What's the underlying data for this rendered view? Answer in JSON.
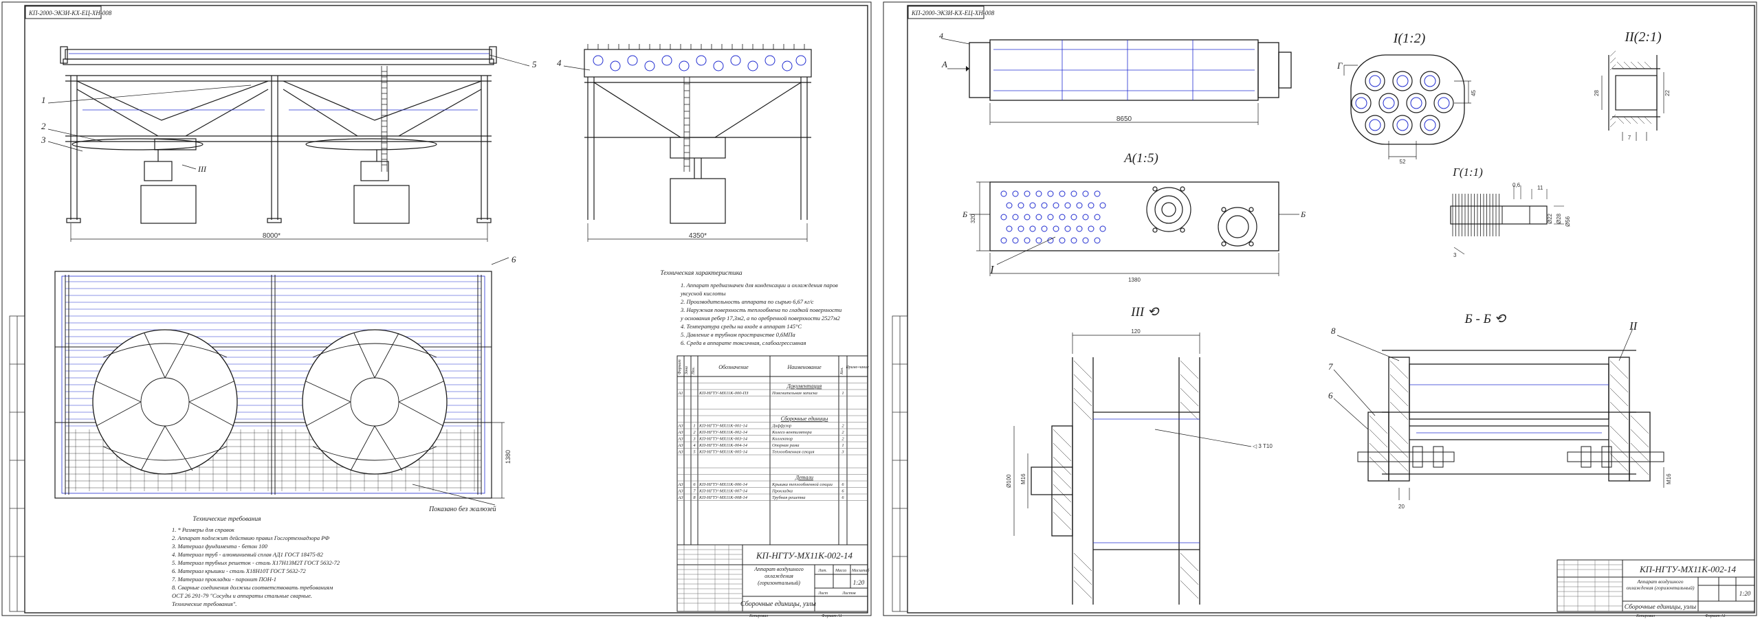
{
  "sheet1": {
    "stamp": "КП-2000-ЭКЗИ-КХ-ЕЦ-ХН-008",
    "positions": [
      "1",
      "2",
      "3",
      "4",
      "5",
      "6"
    ],
    "dims": {
      "length": "8000*",
      "width": "4350*",
      "section_height": "1380"
    },
    "callout_iii": "III",
    "label_hidden": "Показано без жалюзей",
    "tech_char": {
      "title": "Техническая характеристика",
      "lines": [
        "1. Аппарат предназначен для конденсации и охлаждения паров",
        "уксусной кислоты",
        "2. Производительность аппарата по сырью 6,67 кг/с",
        "3. Наружная поверхность теплообмена по гладкой поверхности",
        "у основания ребер 17,3м2, а по оребренной поверхности 2527м2",
        "4. Температура среды на входе в аппарат 145°С",
        "5. Давление в трубном пространстве 0,6МПа",
        "6. Среда в аппарате токсичная, слабоагрессивная"
      ]
    },
    "tech_req": {
      "title": "Технические требования",
      "lines": [
        "1. * Размеры для справок",
        "2. Аппарат подлежит действию правил Госгортехнадзора РФ",
        "3. Материал фундамента - бетон 100",
        "4. Материал труб - алюминиевый сплав АД1 ГОСТ 18475-82",
        "5. Материал трубных решеток - сталь Х17Н13М2Т ГОСТ 5632-72",
        "6. Материал крышки - сталь Х18Н10Т ГОСТ 5632-72",
        "7. Материал прокладки - паронит ПОН-1",
        "8. Сварные соединения должны соответствовать требованиям",
        "ОСТ 26 291-79 \"Сосуды и аппараты стальные сварные.",
        "Технические требования\"."
      ]
    },
    "spec": {
      "headers": [
        "Формат",
        "Зона",
        "Поз.",
        "Обозначение",
        "Наименование",
        "Кол.",
        "Приме-чание"
      ],
      "sections": [
        {
          "title": "Документация",
          "rows": [
            {
              "f": "А1",
              "z": "",
              "p": "",
              "code": "КП-НГТУ-МХ11К-000-ПЗ",
              "name": "Пояснительная записка",
              "q": "1"
            }
          ]
        },
        {
          "title": "Сборочные единицы",
          "rows": [
            {
              "f": "А3",
              "z": "",
              "p": "1",
              "code": "КП-НГТУ-МХ11К-001-14",
              "name": "Диффузор",
              "q": "2"
            },
            {
              "f": "А3",
              "z": "",
              "p": "2",
              "code": "КП-НГТУ-МХ11К-002-14",
              "name": "Колесо вентилятора",
              "q": "2"
            },
            {
              "f": "А3",
              "z": "",
              "p": "3",
              "code": "КП-НГТУ-МХ11К-003-14",
              "name": "Коллектор",
              "q": "2"
            },
            {
              "f": "А3",
              "z": "",
              "p": "4",
              "code": "КП-НГТУ-МХ11К-004-14",
              "name": "Опорная рама",
              "q": "1"
            },
            {
              "f": "А3",
              "z": "",
              "p": "5",
              "code": "КП-НГТУ-МХ11К-005-14",
              "name": "Теплообменная секция",
              "q": "3"
            }
          ]
        },
        {
          "title": "Детали",
          "rows": [
            {
              "f": "А3",
              "z": "",
              "p": "6",
              "code": "КП-НГТУ-МХ11К-006-14",
              "name": "Крышка теплообменной секции",
              "q": "6"
            },
            {
              "f": "А3",
              "z": "",
              "p": "7",
              "code": "КП-НГТУ-МХ11К-007-14",
              "name": "Прокладка",
              "q": "6"
            },
            {
              "f": "А3",
              "z": "",
              "p": "8",
              "code": "КП-НГТУ-МХ11К-008-14",
              "name": "Трубная решетка",
              "q": "6"
            }
          ]
        }
      ]
    },
    "title_block": {
      "code": "КП-НГТУ-МХ11К-002-14",
      "name": "Аппарат воздушного охлаждения (горизонтальный)",
      "subtitle": "Сборочные единицы, узлы",
      "scale": "1:20",
      "lit": "Лит.",
      "mass": "Масса",
      "scale_hdr": "Масштаб",
      "sheet": "Лист",
      "sheets": "Листов",
      "copied": "Копировал",
      "format": "Формат  А1"
    }
  },
  "sheet2": {
    "stamp": "КП-2000-ЭКЗИ-КХ-ЕЦ-ХН-008",
    "views": {
      "i": "I(1:2)",
      "ii": "II(2:1)",
      "a": "А(1:5)",
      "g": "Г(1:1)",
      "iii": "III ⟲",
      "bb": "Б - Б ⟲",
      "view_a": "А",
      "view_g": "Г",
      "section_b": "Б",
      "callout_i": "I",
      "callout_ii": "II"
    },
    "dims": {
      "tube_len": "8650",
      "plate_w": "1380",
      "plate_h": "320",
      "pitch": "52",
      "pitch_v": "45",
      "gap": "7",
      "d1": "28",
      "d2": "22",
      "fin_step": "0,6",
      "fin_w": "11",
      "fin_d1": "Ø22",
      "fin_d2": "Ø28",
      "fin_d3": "Ø56",
      "fin_t": "3",
      "iii_w": "120",
      "iii_d": "Ø100",
      "iii_m": "М16",
      "iii_weld": "◁ 3 Т10",
      "bb_w": "20",
      "bb_m": "М16"
    },
    "positions": [
      "4",
      "6",
      "7",
      "8"
    ],
    "title_block": {
      "code": "КП-НГТУ-МХ11К-002-14",
      "name": "Аппарат воздушного охлаждения (горизонтальный)",
      "subtitle": "Сборочные единицы, узлы",
      "scale": "1:20",
      "copied": "Копировал",
      "format": "Формат  А1"
    }
  },
  "colors": {
    "outline": "#1a1a1a",
    "accent_blue": "#1f2bd0",
    "paper": "#ffffff"
  }
}
